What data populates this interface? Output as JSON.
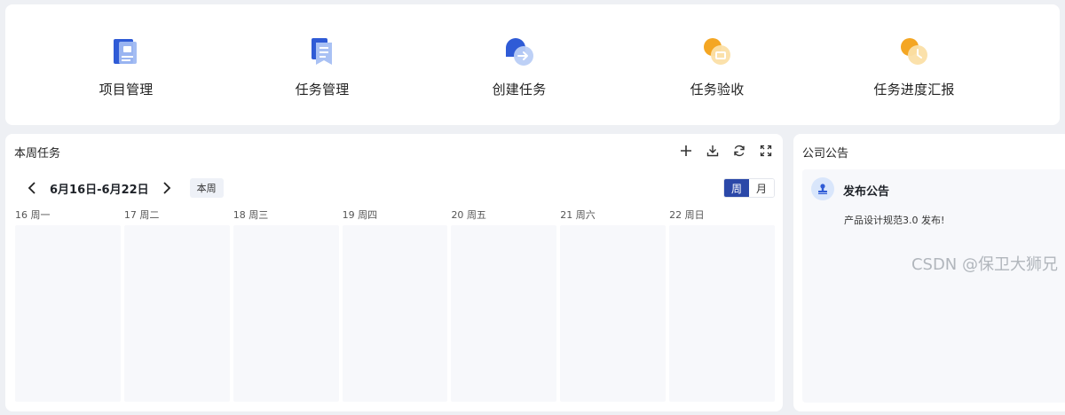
{
  "quick_actions": [
    {
      "label": "项目管理",
      "icon": "project-icon"
    },
    {
      "label": "任务管理",
      "icon": "task-icon"
    },
    {
      "label": "创建任务",
      "icon": "create-task-icon"
    },
    {
      "label": "任务验收",
      "icon": "acceptance-icon"
    },
    {
      "label": "任务进度汇报",
      "icon": "progress-report-icon"
    }
  ],
  "week_tasks": {
    "title": "本周任务",
    "toolbar": [
      "add-icon",
      "download-icon",
      "refresh-icon",
      "fullscreen-icon"
    ],
    "date_range": "6月16日-6月22日",
    "this_week_label": "本周",
    "view_options": [
      "周",
      "月"
    ],
    "active_view": "周",
    "days": [
      {
        "num": "16",
        "weekday": "周一"
      },
      {
        "num": "17",
        "weekday": "周二"
      },
      {
        "num": "18",
        "weekday": "周三"
      },
      {
        "num": "19",
        "weekday": "周四"
      },
      {
        "num": "20",
        "weekday": "周五"
      },
      {
        "num": "21",
        "weekday": "周六"
      },
      {
        "num": "22",
        "weekday": "周日"
      }
    ]
  },
  "announcements": {
    "title": "公司公告",
    "item_title": "发布公告",
    "item_text": "产品设计规范3.0 发布!"
  },
  "watermark": "CSDN @保卫大狮兄",
  "colors": {
    "accent": "#2b48a8",
    "icon_blue": "#2f5bd6",
    "icon_orange": "#f4a623",
    "panel_bg": "#f7f8fb"
  }
}
